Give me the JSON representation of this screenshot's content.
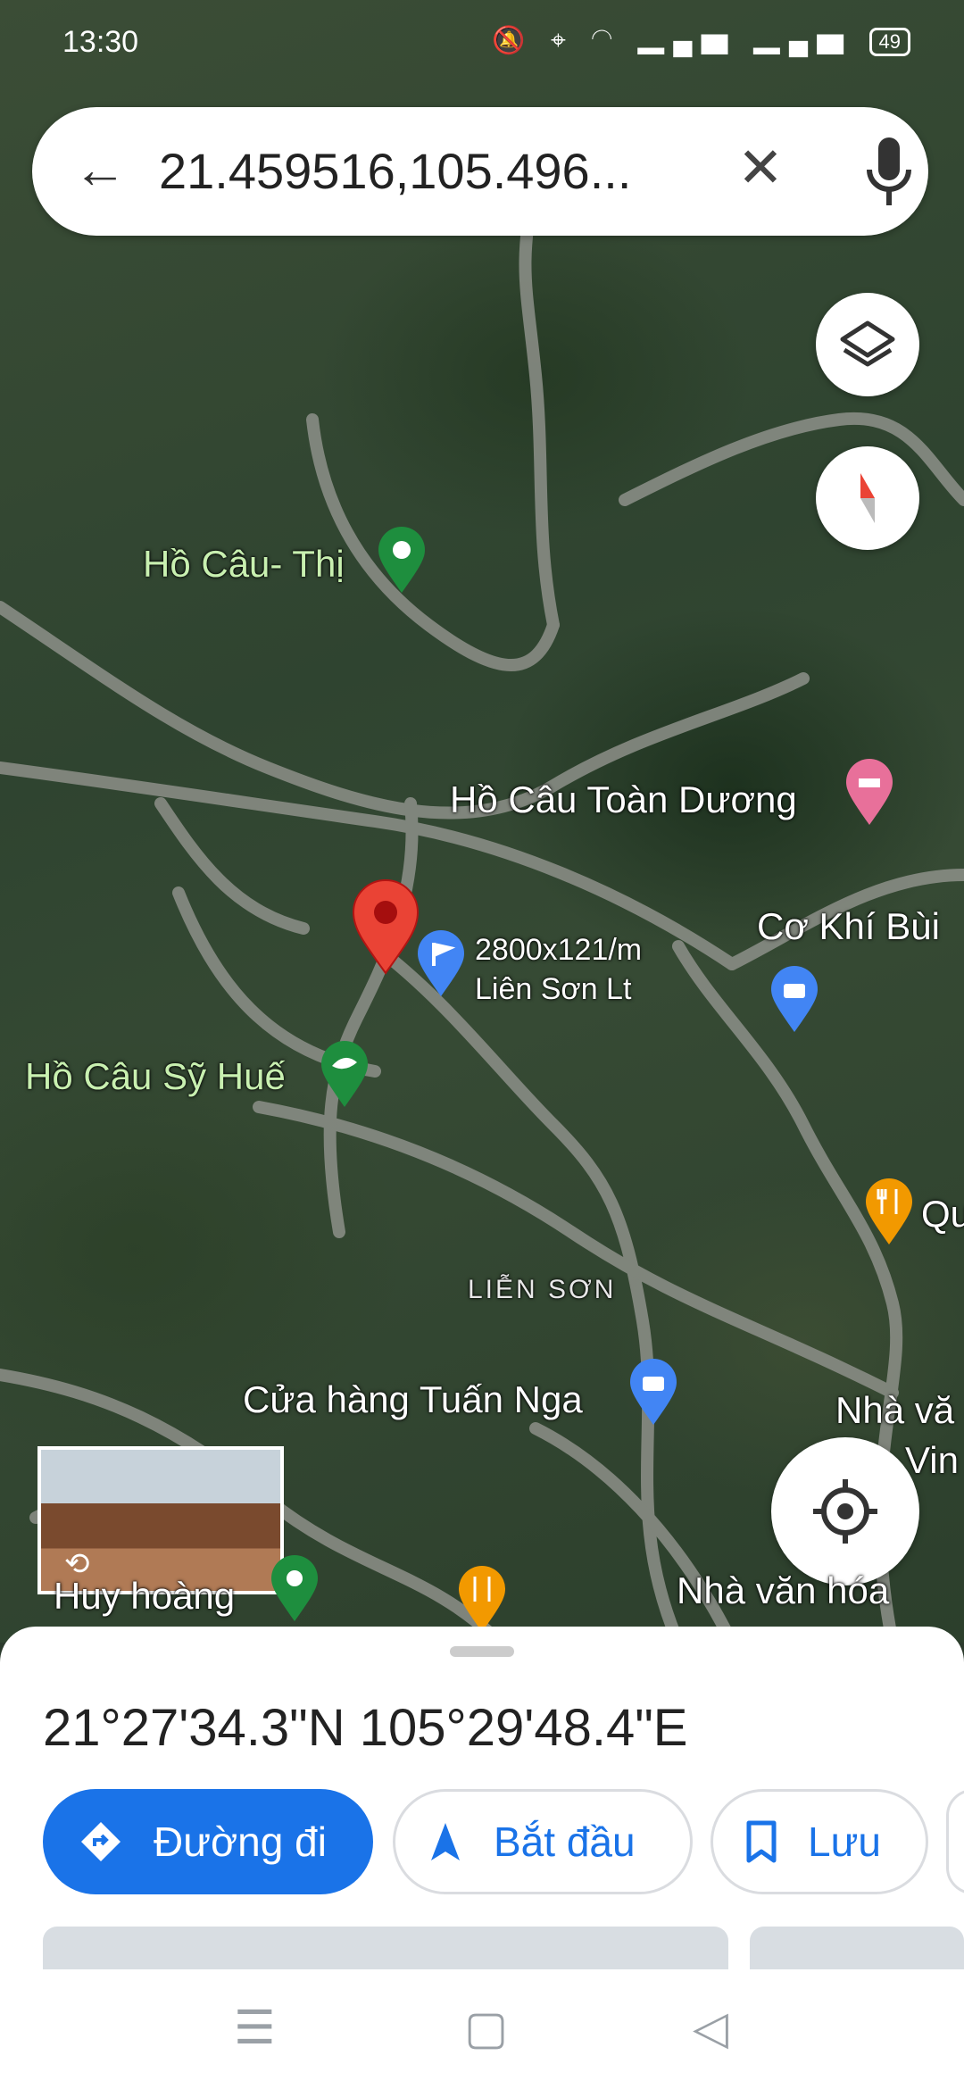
{
  "status_bar": {
    "time": "13:30",
    "battery": "49"
  },
  "search": {
    "query": "21.459516,105.496..."
  },
  "map_labels": {
    "ho_cau_thi": "Hồ Câu- Thị",
    "ho_cau_toan_duong": "Hồ Câu Toàn Dương",
    "co_khi_bui": "Cơ Khí Bùi",
    "place_line1": "2800x121/m",
    "place_line2": "Liên Sơn Lt",
    "ho_cau_sy_hue": "Hồ Câu Sỹ Huế",
    "qu": "Qu",
    "area": "LIỄN SƠN",
    "cua_hang": "Cửa hàng Tuấn Nga",
    "nha_van_1": "Nhà vă",
    "vin": "Vin",
    "huy_hoang": "Huy hoàng",
    "nha_van_hoa": "Nhà văn hóa"
  },
  "sheet": {
    "coordinates": "21°27'34.3\"N 105°29'48.4\"E",
    "directions_label": "Đường đi",
    "start_label": "Bắt đầu",
    "save_label": "Lưu"
  },
  "colors": {
    "primary": "#1a73e8",
    "pin_red": "#ea4335"
  },
  "icons": [
    "back-arrow-icon",
    "close-icon",
    "mic-icon",
    "layers-icon",
    "compass-icon",
    "my-location-icon",
    "directions-icon",
    "navigation-icon",
    "bookmark-icon",
    "menu-icon",
    "home-icon",
    "back-icon"
  ]
}
